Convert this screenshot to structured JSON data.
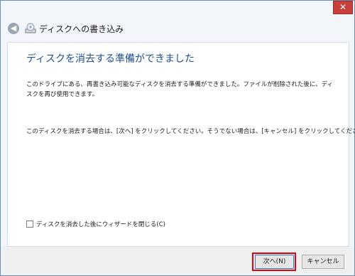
{
  "window": {
    "close_glyph": "✕",
    "wizard_title": "ディスクへの書き込み"
  },
  "content": {
    "heading": "ディスクを消去する準備ができました",
    "body": "このドライブにある、再書き込み可能なディスクを消去する準備ができました。ファイルが削除された後に、ディスクを再び使用できます。",
    "instruction": "このディスクを消去する場合は、[次へ] をクリックしてください。そうでない場合は、[キャンセル] をクリックしてください。",
    "close_checkbox": {
      "label": "ディスクを消去した後にウィザードを閉じる(C)",
      "checked": false
    }
  },
  "footer": {
    "next_label": "次へ(N)",
    "cancel_label": "キャンセル"
  },
  "colors": {
    "heading": "#1d4f91",
    "highlight": "#e0001b",
    "close_button": "#c9403a"
  },
  "icons": [
    "close-icon",
    "back-arrow-icon",
    "disc-burner-icon"
  ]
}
